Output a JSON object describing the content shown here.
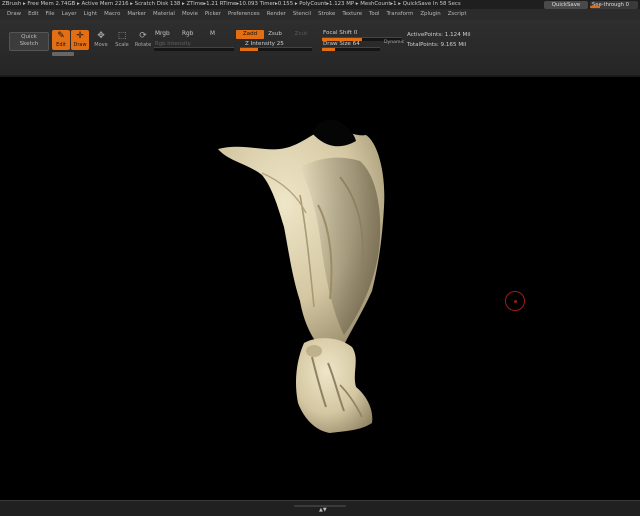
{
  "status_bar": {
    "text": "ZBrush  ▸ Free Mem 2.74GB ▸ Active Mem 2216 ▸ Scratch Disk 138 ▸  ZTime▸1.21  RTime▸10.093  Timer▸0.155 ▸ PolyCount▸1.123  MP  ▸ MeshCount▸1   ▸ QuickSave In 58 Secs",
    "quicksave_label": "QuickSave",
    "see_through_label": "See-through  0",
    "see_through_value": 0.2
  },
  "menu": [
    "Draw",
    "Edit",
    "File",
    "Layer",
    "Light",
    "Macro",
    "Marker",
    "Material",
    "Movie",
    "Picker",
    "Preferences",
    "Render",
    "Stencil",
    "Stroke",
    "Texture",
    "Tool",
    "Transform",
    "Zplugin",
    "Zscript"
  ],
  "toolbar": {
    "quick_sketch": [
      "Quick",
      "Sketch"
    ],
    "modes": [
      {
        "icon": "✎",
        "label": "Edit",
        "active": true
      },
      {
        "icon": "✛",
        "label": "Draw",
        "active": true
      },
      {
        "icon": "✥",
        "label": "Move",
        "active": false
      },
      {
        "icon": "⬚",
        "label": "Scale",
        "active": false
      },
      {
        "icon": "⟳",
        "label": "Rotate",
        "active": false
      }
    ],
    "mrgb": "Mrgb",
    "rgb": "Rgb",
    "m": "M",
    "rgb_intensity": "Rgb Intensity",
    "zadd": "Zadd",
    "zsub": "Zsub",
    "zcut": "Zcut",
    "z_intensity_label": "Z Intensity 25",
    "z_intensity": 0.25,
    "focal_shift_label": "Focal Shift 0",
    "focal_shift": 0.5,
    "draw_size_label": "Draw Size 64",
    "draw_size": 0.22,
    "dynamic": "Dynamic",
    "active_points": "ActivePoints: 1.124  Mil",
    "total_points": "TotalPoints: 9.165  Mil"
  },
  "colors": {
    "accent": "#e46e12",
    "clay": "#d8ccaa",
    "cursor": "#a11c1c"
  }
}
